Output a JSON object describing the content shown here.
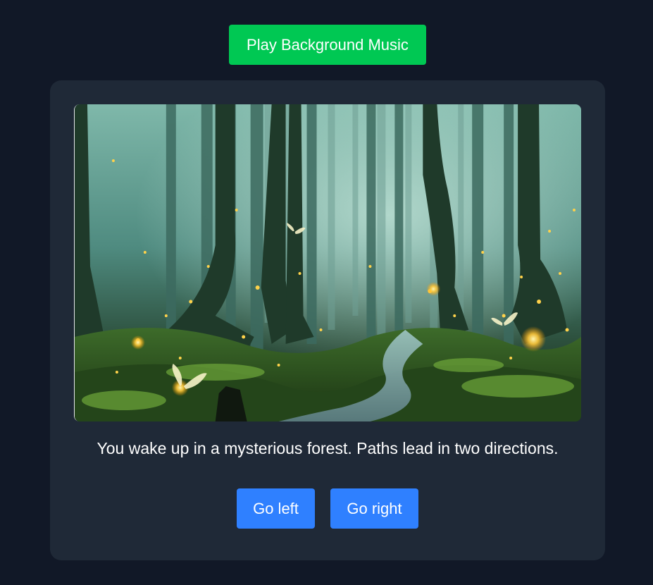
{
  "music_button": {
    "label": "Play Background Music"
  },
  "scene": {
    "image_name": "forest-image"
  },
  "story": {
    "text": "You wake up in a mysterious forest. Paths lead in two directions."
  },
  "choices": [
    {
      "label": "Go left"
    },
    {
      "label": "Go right"
    }
  ],
  "colors": {
    "background": "#111827",
    "card": "#1f2937",
    "music_button": "#00c853",
    "choice_button": "#2f80ff"
  }
}
